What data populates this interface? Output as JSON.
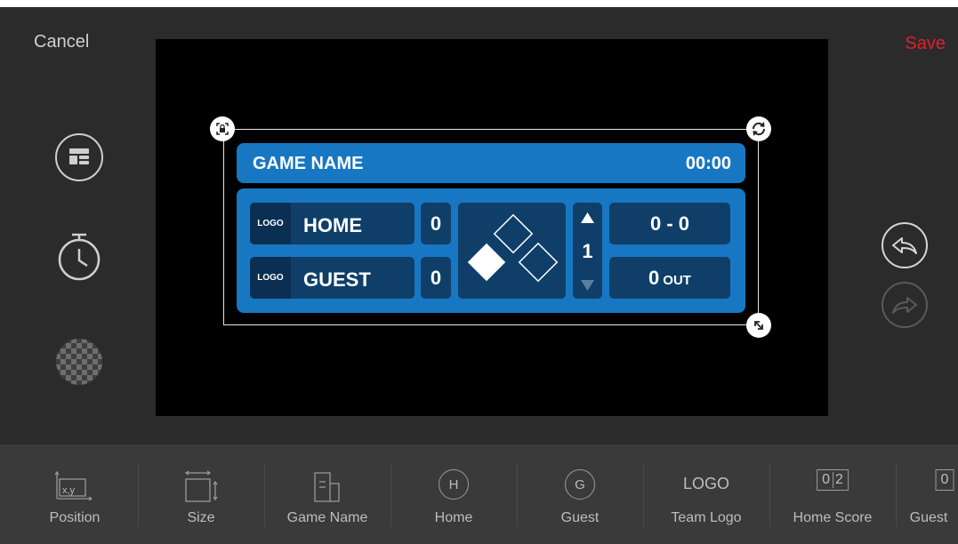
{
  "topbar": {
    "cancel_label": "Cancel",
    "save_label": "Save"
  },
  "left_tools": [
    "layout-icon",
    "timer-icon",
    "transparency-icon"
  ],
  "scoreboard": {
    "game_name": "GAME NAME",
    "clock": "00:00",
    "home": {
      "logo": "LOGO",
      "name": "HOME",
      "score": "0"
    },
    "guest": {
      "logo": "LOGO",
      "name": "GUEST",
      "score": "0"
    },
    "inning": "1",
    "count": "0 - 0",
    "outs_value": "0",
    "outs_label": "OUT"
  },
  "right_tools": [
    "undo-icon",
    "redo-icon"
  ],
  "bottom_tools": [
    {
      "label": "Position",
      "icon": "position-icon",
      "icon_text": "x,y"
    },
    {
      "label": "Size",
      "icon": "size-icon"
    },
    {
      "label": "Game Name",
      "icon": "game-name-icon"
    },
    {
      "label": "Home",
      "icon": "home-icon",
      "icon_text": "H"
    },
    {
      "label": "Guest",
      "icon": "guest-icon",
      "icon_text": "G"
    },
    {
      "label": "Team Logo",
      "icon": "team-logo-icon",
      "icon_text": "LOGO"
    },
    {
      "label": "Home Score",
      "icon": "home-score-icon",
      "icon_text": [
        "0",
        "2"
      ]
    },
    {
      "label": "Guest",
      "icon": "guest-score-icon",
      "icon_text": "0"
    }
  ],
  "colors": {
    "accent_red": "#e0202a",
    "scoreboard_blue": "#1877c2",
    "scoreboard_cell": "#0f3f69"
  }
}
